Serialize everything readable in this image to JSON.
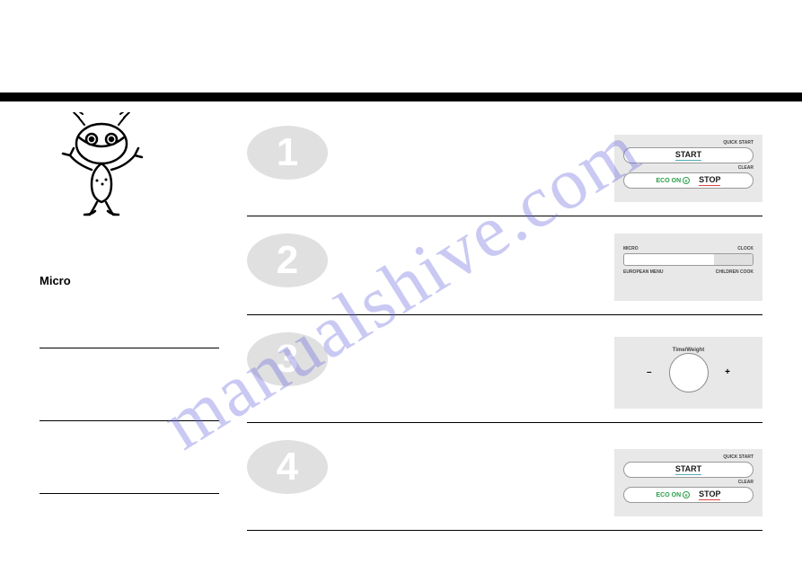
{
  "watermark": "manualshive.com",
  "left": {
    "micro": "Micro"
  },
  "steps": {
    "n1": "1",
    "n2": "2",
    "n3": "3",
    "n4": "4"
  },
  "panel1": {
    "quickstart": "QUICK START",
    "start": "START",
    "clear": "CLEAR",
    "eco": "ECO ON",
    "stop": "STOP"
  },
  "panel2": {
    "micro": "MICRO",
    "clock": "CLOCK",
    "euromenu": "EUROPEAN MENU",
    "childcook": "CHILDREN COOK"
  },
  "panel3": {
    "timeweight": "Time/Weight",
    "minus": "–",
    "plus": "+"
  },
  "panel4": {
    "quickstart": "QUICK START",
    "start": "START",
    "clear": "CLEAR",
    "eco": "ECO ON",
    "stop": "STOP"
  }
}
